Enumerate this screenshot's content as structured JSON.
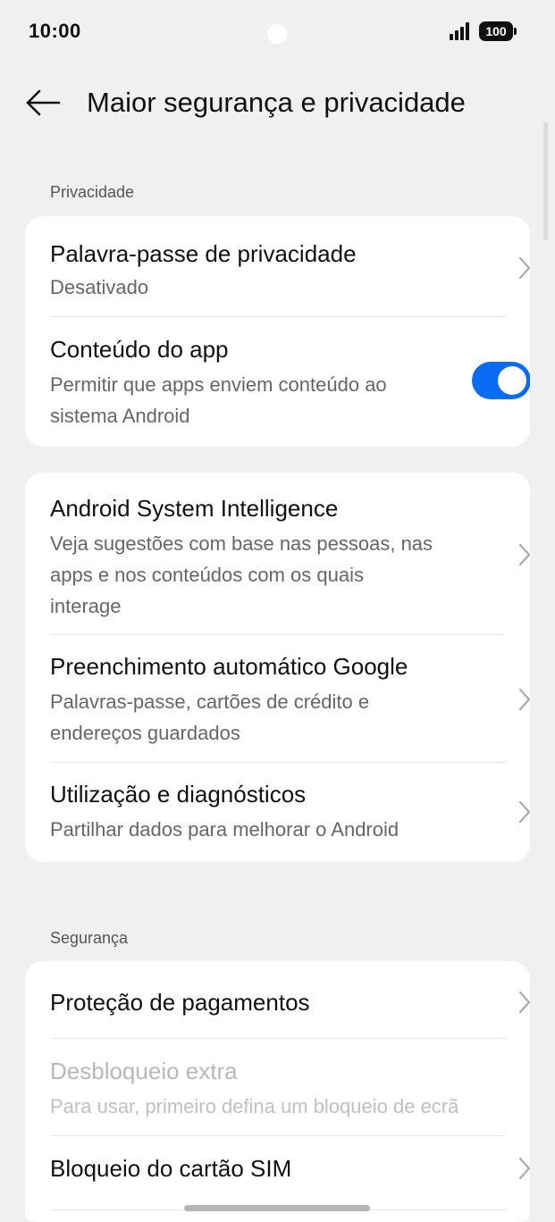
{
  "status_bar": {
    "time": "10:00",
    "battery": "100"
  },
  "header": {
    "title": "Maior segurança e privacidade"
  },
  "sections": {
    "privacy_label": "Privacidade",
    "security_label": "Segurança"
  },
  "privacy_card": {
    "password": {
      "title": "Palavra-passe de privacidade",
      "subtitle": "Desativado"
    },
    "app_content": {
      "title": "Conteúdo do app",
      "subtitle": "Permitir que apps enviem conteúdo ao sistema Android",
      "enabled": true
    }
  },
  "services_card": {
    "asi": {
      "title": "Android System Intelligence",
      "subtitle": "Veja sugestões com base nas pessoas, nas apps e nos conteúdos com os quais interage"
    },
    "autofill": {
      "title": "Preenchimento automático Google",
      "subtitle": "Palavras-passe, cartões de crédito e endereços guardados"
    },
    "diagnostics": {
      "title": "Utilização e diagnósticos",
      "subtitle": "Partilhar dados para melhorar o Android"
    }
  },
  "security_card": {
    "payments": {
      "title": "Proteção de pagamentos"
    },
    "extra_unlock": {
      "title": "Desbloqueio extra",
      "subtitle": "Para usar, primeiro defina um bloqueio de ecrã"
    },
    "sim_lock": {
      "title": "Bloqueio do cartão SIM"
    }
  },
  "colors": {
    "accent": "#0a6cf5",
    "background": "#f0f0f3",
    "card": "#ffffff"
  },
  "icons": {
    "back": "arrow-left-icon",
    "chevron": "chevron-right-icon",
    "signal": "signal-icon",
    "battery": "battery-icon"
  }
}
